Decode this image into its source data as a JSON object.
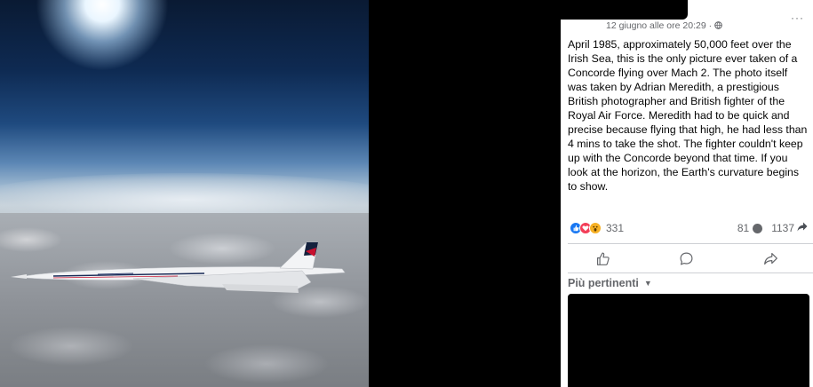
{
  "post": {
    "date": "12 giugno alle ore 20:29 · ",
    "more": "···",
    "text": "April 1985, approximately 50,000 feet over the Irish Sea, this is the only picture ever taken of a Concorde flying over Mach 2. The photo itself was taken by Adrian Meredith, a prestigious British photographer and British fighter of the Royal Air Force. Meredith had to be quick and precise because flying that high, he had less than 4 mins to take the shot. The fighter couldn't keep up with the Concorde beyond that time. If you look at the horizon, the Earth's curvature begins to show.",
    "reaction_count": "331",
    "comment_count": "81",
    "share_count": "1137"
  },
  "comments": {
    "sort_label": "Più pertinenti"
  },
  "icons": {
    "globe": "globe-icon",
    "like": "like-icon",
    "comment": "comment-icon",
    "share": "share-icon"
  },
  "colors": {
    "like": "#1877f2",
    "love": "#f33e58",
    "wow": "#f7b125",
    "secondary_text": "#65676b"
  }
}
